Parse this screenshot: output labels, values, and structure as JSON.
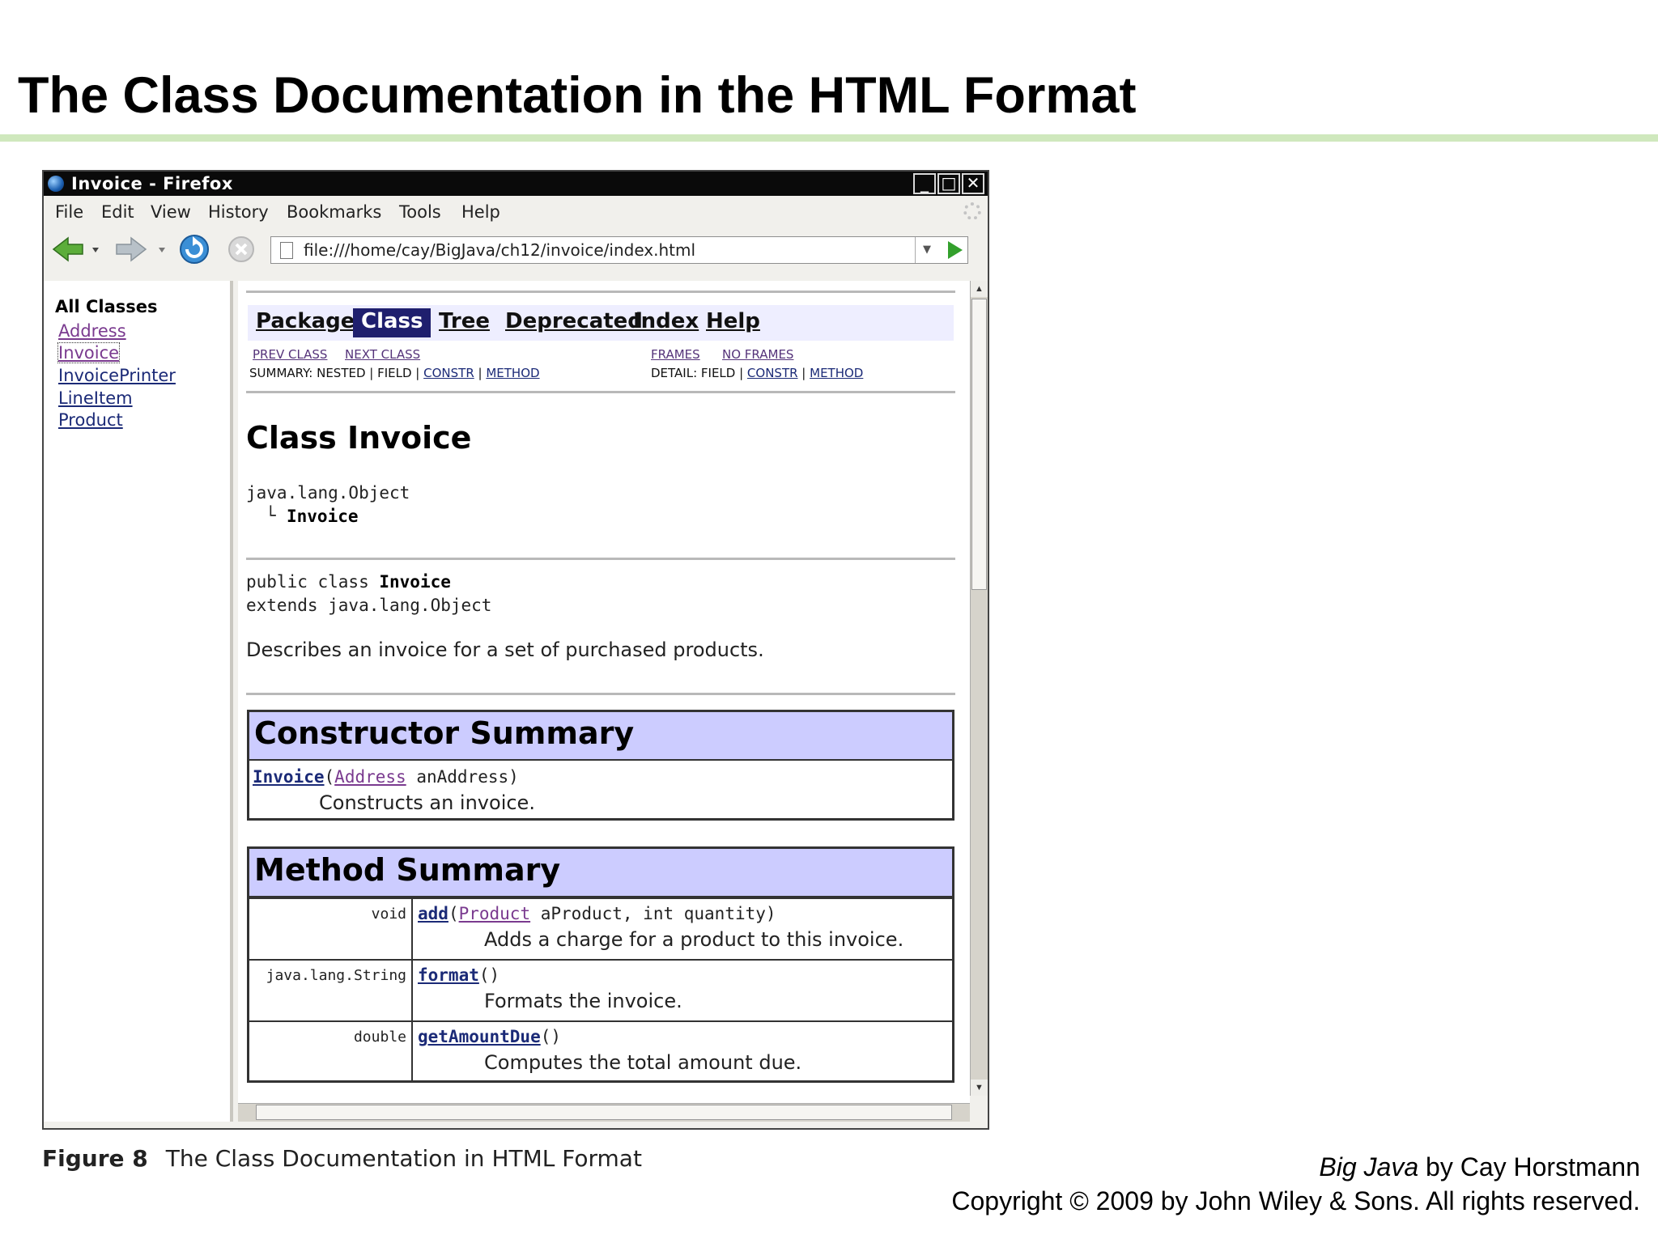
{
  "slide": {
    "title": "The Class Documentation in the HTML Format",
    "caption_figure": "Figure 8",
    "caption_text": "The Class Documentation in HTML Format",
    "credit_book": "Big Java",
    "credit_author": " by Cay Horstmann",
    "copyright": "Copyright © 2009 by John Wiley & Sons.  All rights reserved."
  },
  "window": {
    "title": "Invoice - Firefox",
    "buttons": {
      "minimize": "_",
      "maximize": "□",
      "close": "✕"
    },
    "menu": [
      "File",
      "Edit",
      "View",
      "History",
      "Bookmarks",
      "Tools",
      "Help"
    ],
    "url": "file:///home/cay/BigJava/ch12/invoice/index.html"
  },
  "left_frame": {
    "heading": "All Classes",
    "classes": [
      "Address",
      "Invoice",
      "InvoicePrinter",
      "LineItem",
      "Product"
    ]
  },
  "doc": {
    "nav": [
      "Package",
      "Class",
      "Tree",
      "Deprecated",
      "Index",
      "Help"
    ],
    "prev_class": "PREV CLASS",
    "next_class": "NEXT CLASS",
    "frames": "FRAMES",
    "no_frames": "NO FRAMES",
    "summary_prefix": "SUMMARY: NESTED | FIELD | ",
    "detail_prefix": "DETAIL: FIELD | ",
    "constr": "CONSTR",
    "sep": " | ",
    "method": "METHOD",
    "class_heading": "Class Invoice",
    "hierarchy_root": "java.lang.Object",
    "hierarchy_branch": "└",
    "hierarchy_child": "Invoice",
    "decl_prefix": "public class ",
    "decl_name": "Invoice",
    "decl_extends": "extends java.lang.Object",
    "description": "Describes an invoice for a set of purchased products.",
    "constructor_summary": {
      "heading": "Constructor Summary",
      "name": "Invoice",
      "open": "(",
      "param_type": "Address",
      "param_rest": " anAddress)",
      "desc": "Constructs an invoice."
    },
    "method_summary": {
      "heading": "Method Summary",
      "rows": [
        {
          "type": "void",
          "name": "add",
          "open": "(",
          "param_type": "Product",
          "param_rest": " aProduct, int quantity)",
          "desc": "Adds a charge for a product to this invoice."
        },
        {
          "type": "java.lang.String",
          "name": "format",
          "open": "",
          "param_type": "",
          "param_rest": "()",
          "desc": "Formats the invoice."
        },
        {
          "type": "double",
          "name": "getAmountDue",
          "open": "",
          "param_type": "",
          "param_rest": "()",
          "desc": "Computes the total amount due."
        }
      ]
    }
  }
}
